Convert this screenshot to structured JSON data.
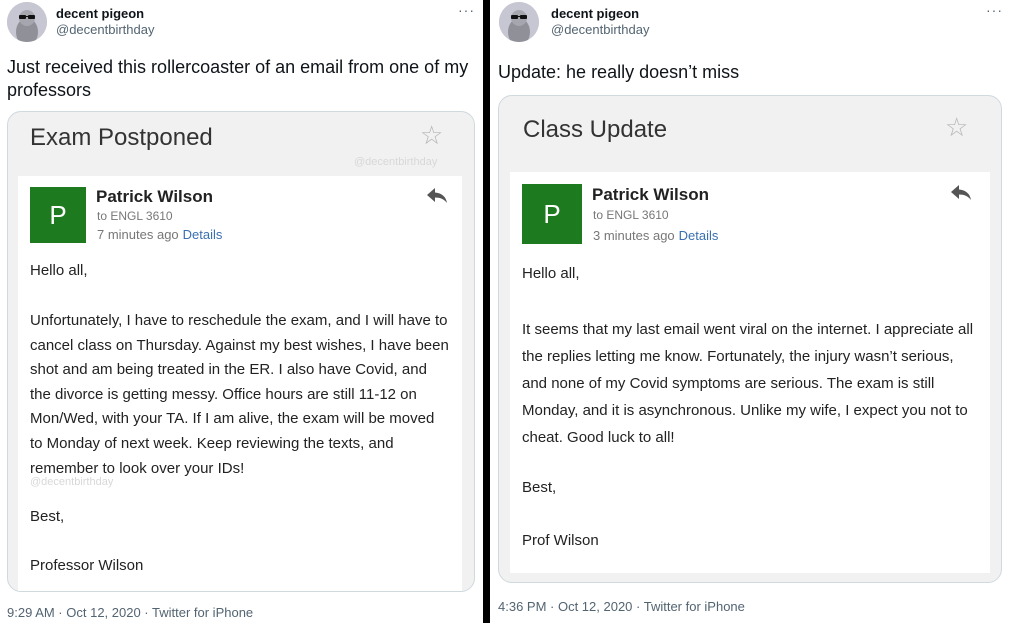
{
  "left": {
    "user": {
      "name": "decent pigeon",
      "handle": "@decentbirthday"
    },
    "more": "···",
    "tweet_text": "Just received this rollercoaster of an email from one of my professors",
    "email": {
      "subject": "Exam Postponed",
      "watermark": "@decentbirthday",
      "sender_initial": "P",
      "sender": "Patrick Wilson",
      "to": "to ENGL 3610",
      "time": "7 minutes ago",
      "details": "Details",
      "greeting": "Hello all,",
      "body": "Unfortunately, I have to reschedule the exam, and I will have to cancel class on Thursday. Against my best wishes, I have been shot and am being treated in the ER. I also have Covid, and the divorce is getting messy. Office hours are still 11-12 on Mon/Wed, with your TA. If I am alive, the exam will be moved to Monday of next week. Keep reviewing the texts, and remember to look over your IDs!",
      "signoff": "Best,",
      "signature": "Professor Wilson"
    },
    "footer": "9:29 AM · Oct 12, 2020 · Twitter for iPhone"
  },
  "right": {
    "user": {
      "name": "decent pigeon",
      "handle": "@decentbirthday"
    },
    "more": "···",
    "tweet_text": "Update: he really doesn’t miss",
    "email": {
      "subject": "Class Update",
      "sender_initial": "P",
      "sender": "Patrick Wilson",
      "to": "to ENGL 3610",
      "time": "3 minutes ago",
      "details": "Details",
      "greeting": "Hello all,",
      "body": "It seems that my last email went viral on the internet. I appreciate all the replies letting me know. Fortunately, the injury wasn’t serious, and none of my Covid symptoms are serious. The exam is still Monday, and it is asynchronous. Unlike my wife, I expect you not to cheat. Good luck to all!",
      "signoff": "Best,",
      "signature": "Prof Wilson"
    },
    "footer": "4:36 PM · Oct 12, 2020 · Twitter for iPhone"
  },
  "colors": {
    "sender_avatar": "#1e7a1e",
    "details_link": "#3a6fb0"
  }
}
